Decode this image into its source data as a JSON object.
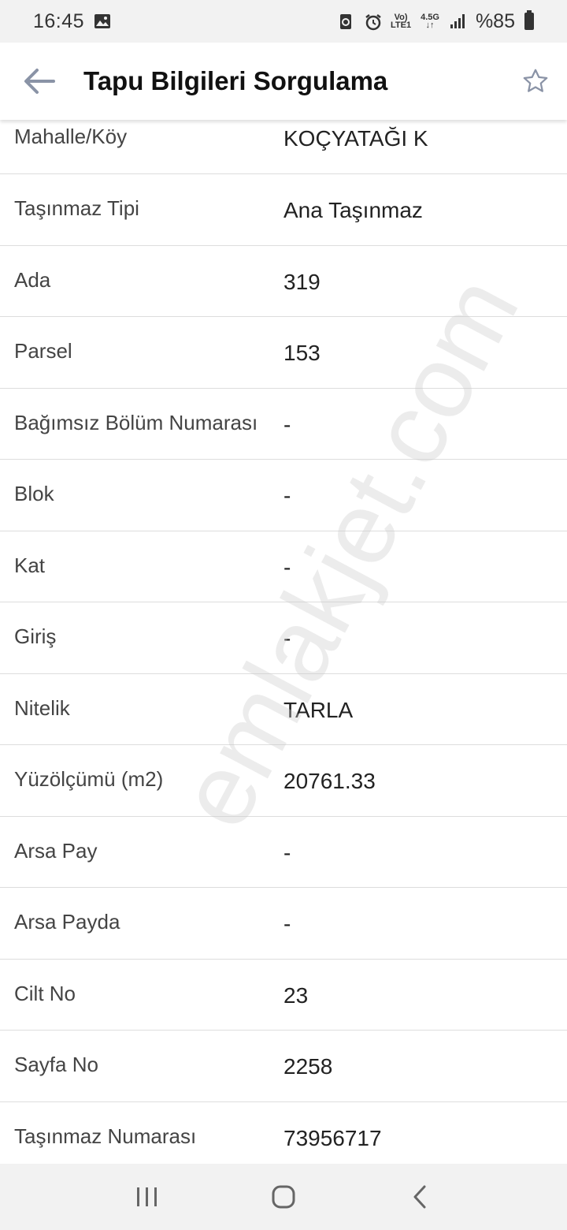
{
  "status_bar": {
    "time": "16:45",
    "network_top": "Vo)",
    "network_bottom": "LTE1",
    "data_type": "4.5G",
    "battery_text": "%85"
  },
  "app_bar": {
    "title": "Tapu Bilgileri Sorgulama"
  },
  "rows": [
    {
      "label": "Mahalle/Köy",
      "value": "KOÇYATAĞI K"
    },
    {
      "label": "Taşınmaz Tipi",
      "value": "Ana Taşınmaz"
    },
    {
      "label": "Ada",
      "value": "319"
    },
    {
      "label": "Parsel",
      "value": "153"
    },
    {
      "label": "Bağımsız Bölüm Numarası",
      "value": "-"
    },
    {
      "label": "Blok",
      "value": "-"
    },
    {
      "label": "Kat",
      "value": "-"
    },
    {
      "label": "Giriş",
      "value": "-"
    },
    {
      "label": "Nitelik",
      "value": "TARLA"
    },
    {
      "label": "Yüzölçümü (m2)",
      "value": "20761.33"
    },
    {
      "label": "Arsa Pay",
      "value": "-"
    },
    {
      "label": "Arsa Payda",
      "value": "-"
    },
    {
      "label": "Cilt No",
      "value": "23"
    },
    {
      "label": "Sayfa No",
      "value": "2258"
    },
    {
      "label": "Taşınmaz Numarası",
      "value": "73956717"
    }
  ],
  "watermark": "emlakjet.com"
}
